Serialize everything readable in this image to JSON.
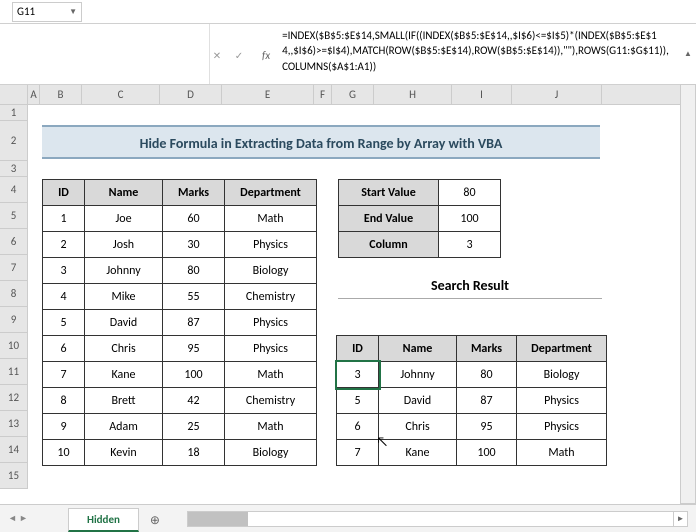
{
  "name_box": "G11",
  "fx_label": "fx",
  "formula": "=INDEX($B$5:$E$14,SMALL(IF((INDEX($B$5:$E$14,,$I$6)<=$I$5)*(INDEX($B$5:$E$14,,$I$6)>=$I$4),MATCH(ROW($B$5:$E$14),ROW($B$5:$E$14)),\"\"),ROWS(G11:$G$11)),COLUMNS($A$1:A1))",
  "columns": [
    "A",
    "B",
    "C",
    "D",
    "E",
    "F",
    "G",
    "H",
    "I",
    "J"
  ],
  "page_title": "Hide Formula in Extracting Data from Range by Array with VBA",
  "table_headers": {
    "id": "ID",
    "name": "Name",
    "marks": "Marks",
    "dept": "Department"
  },
  "students": [
    {
      "id": "1",
      "name": "Joe",
      "marks": "60",
      "dept": "Math"
    },
    {
      "id": "2",
      "name": "Josh",
      "marks": "30",
      "dept": "Physics"
    },
    {
      "id": "3",
      "name": "Johnny",
      "marks": "80",
      "dept": "Biology"
    },
    {
      "id": "4",
      "name": "Mike",
      "marks": "55",
      "dept": "Chemistry"
    },
    {
      "id": "5",
      "name": "David",
      "marks": "87",
      "dept": "Physics"
    },
    {
      "id": "6",
      "name": "Chris",
      "marks": "95",
      "dept": "Physics"
    },
    {
      "id": "7",
      "name": "Kane",
      "marks": "100",
      "dept": "Math"
    },
    {
      "id": "8",
      "name": "Brett",
      "marks": "42",
      "dept": "Chemistry"
    },
    {
      "id": "9",
      "name": "Adam",
      "marks": "25",
      "dept": "Math"
    },
    {
      "id": "10",
      "name": "Kevin",
      "marks": "18",
      "dept": "Biology"
    }
  ],
  "params": {
    "start_label": "Start Value",
    "start_val": "80",
    "end_label": "End Value",
    "end_val": "100",
    "col_label": "Column",
    "col_val": "3"
  },
  "search_title": "Search Result",
  "results": [
    {
      "id": "3",
      "name": "Johnny",
      "marks": "80",
      "dept": "Biology"
    },
    {
      "id": "5",
      "name": "David",
      "marks": "87",
      "dept": "Physics"
    },
    {
      "id": "6",
      "name": "Chris",
      "marks": "95",
      "dept": "Physics"
    },
    {
      "id": "7",
      "name": "Kane",
      "marks": "100",
      "dept": "Math"
    }
  ],
  "sheet_tab": "Hidden",
  "rows": [
    "1",
    "2",
    "3",
    "4",
    "5",
    "6",
    "7",
    "8",
    "9",
    "10",
    "11",
    "12",
    "13",
    "14",
    "15"
  ]
}
